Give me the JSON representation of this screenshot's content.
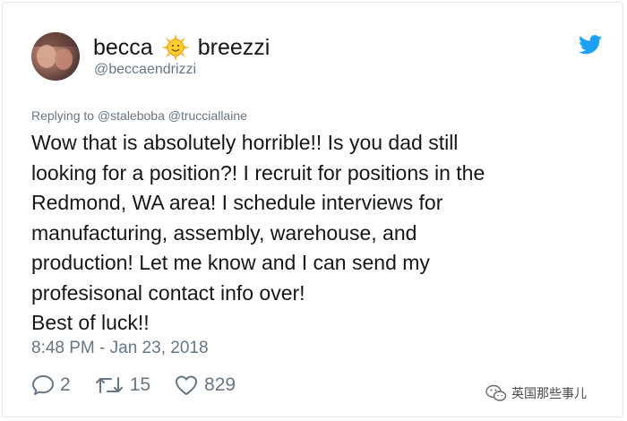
{
  "user": {
    "first_name": "becca",
    "emoji": "sun-with-face",
    "last_name": "breezzi",
    "handle": "@beccaendrizzi"
  },
  "reply": {
    "prefix": "Replying to",
    "mentions": "@staleboba @trucciallaine"
  },
  "tweet": {
    "text": "Wow that is absolutely horrible!! Is you dad still\nlooking for a position?! I recruit for positions in the\nRedmond, WA area!  I schedule interviews for\nmanufacturing, assembly, warehouse, and\nproduction! Let me know and I can send my\nprofesisonal contact info over!\nBest of luck!!",
    "timestamp": "8:48 PM - Jan 23, 2018"
  },
  "actions": {
    "replies": "2",
    "retweets": "15",
    "likes": "829"
  },
  "watermark": {
    "text": "英国那些事儿"
  },
  "colors": {
    "twitter_blue": "#1da1f2",
    "text_primary": "#14171a",
    "text_secondary": "#657786"
  }
}
